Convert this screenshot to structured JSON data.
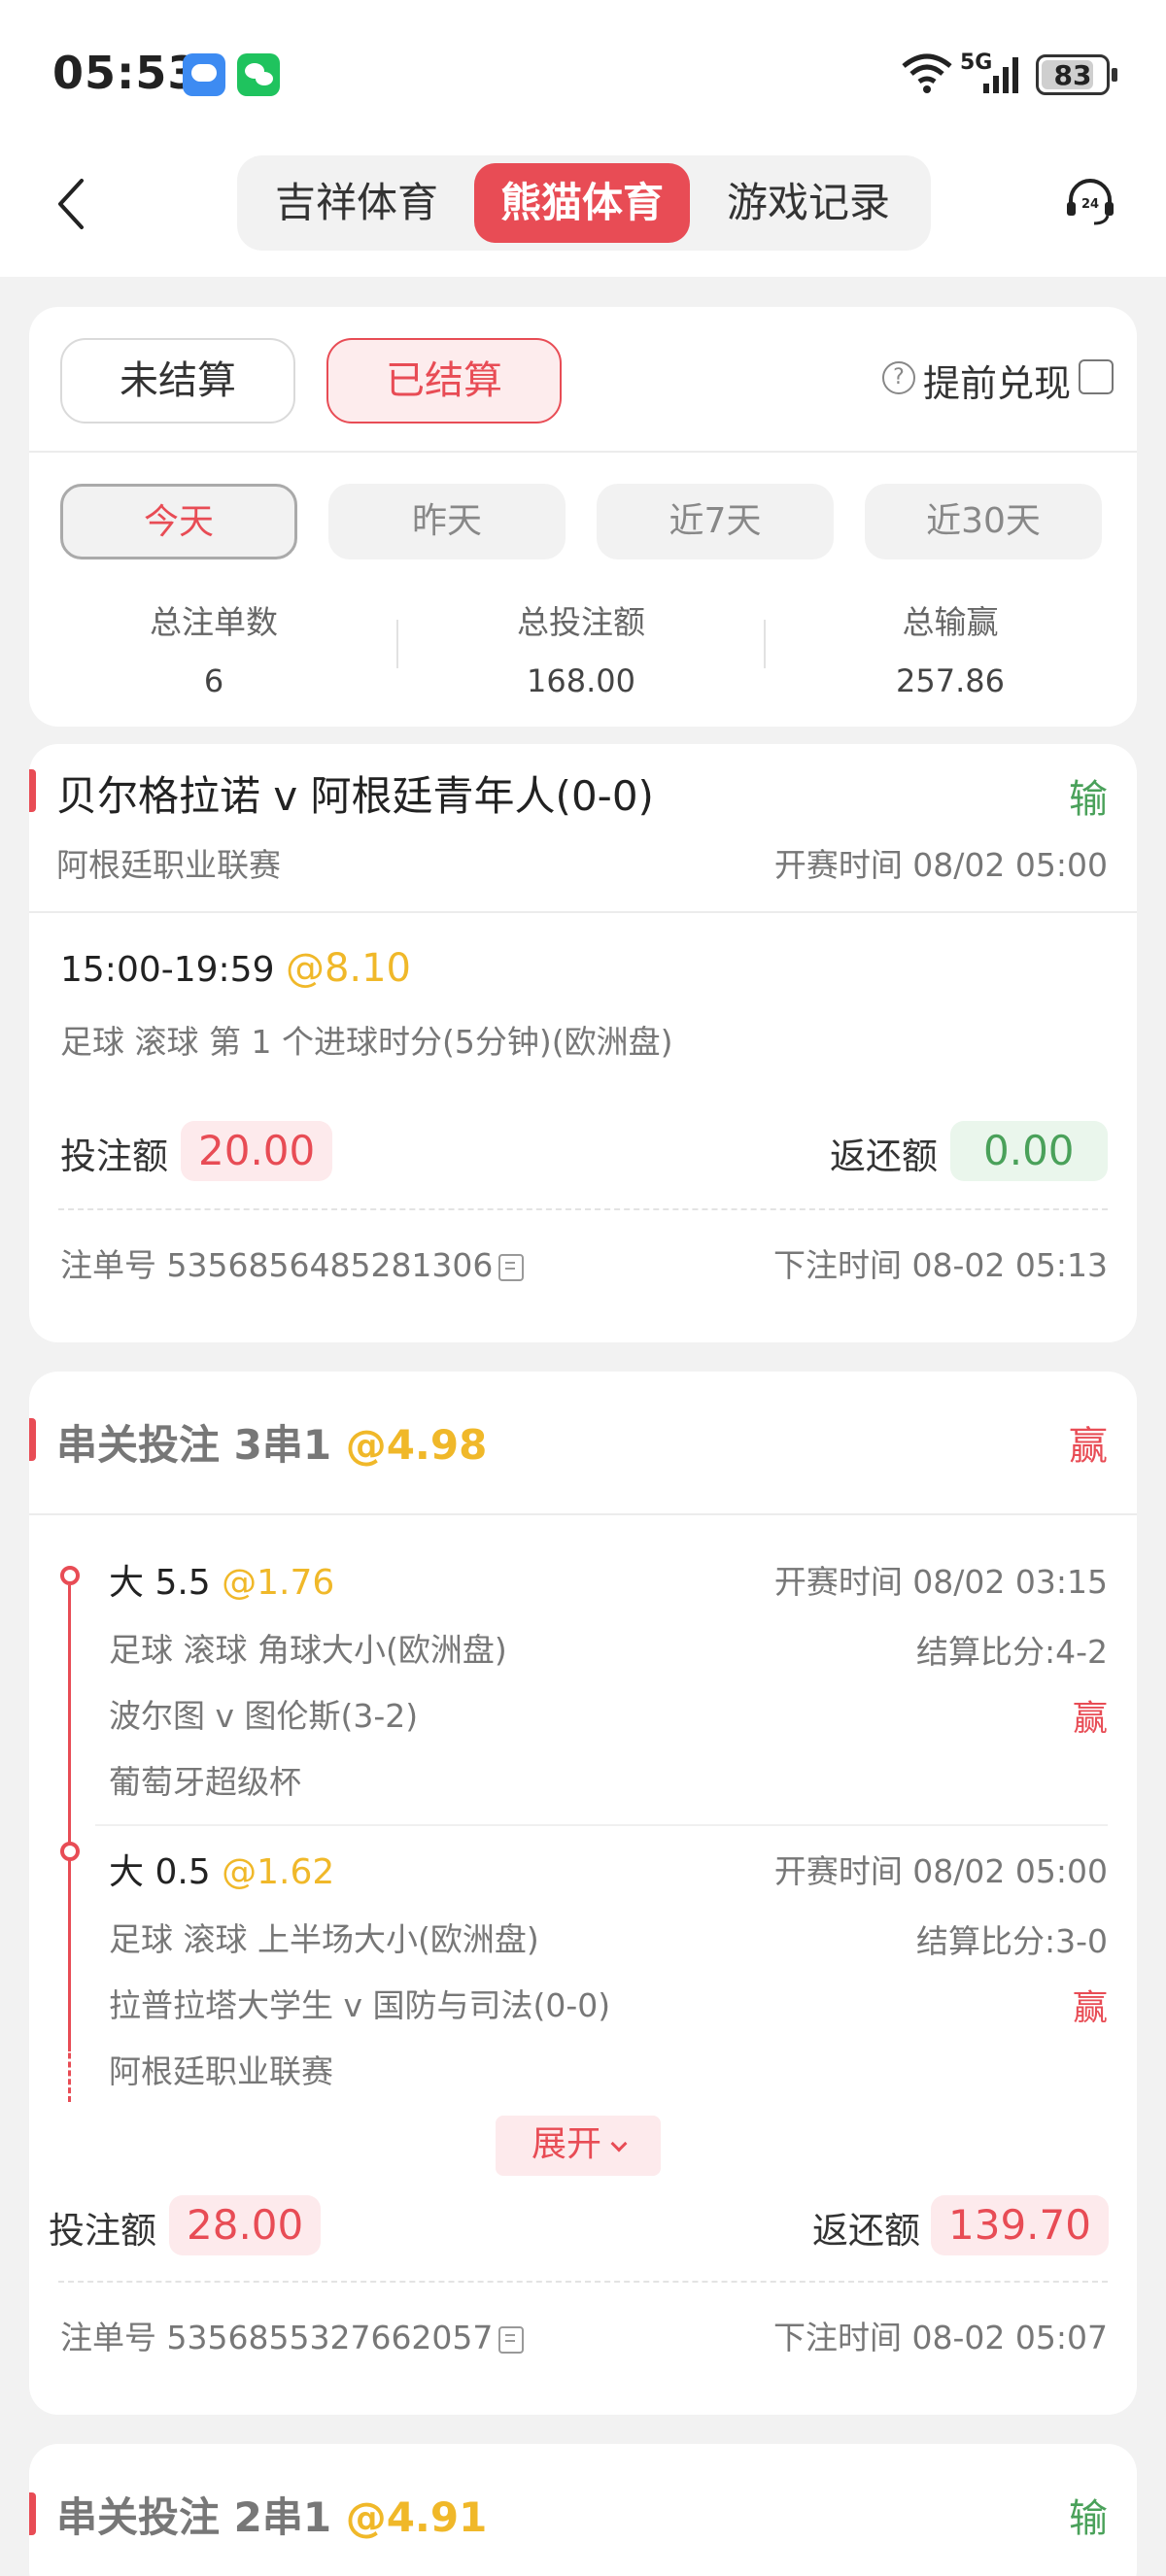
{
  "status_bar": {
    "time": "05:53",
    "network": "5G",
    "battery": "83",
    "battery_level": 0.83
  },
  "header": {
    "tabs": [
      "吉祥体育",
      "熊猫体育",
      "游戏记录"
    ],
    "active_tab": 1
  },
  "filters": {
    "status_tabs": [
      "未结算",
      "已结算"
    ],
    "active_status": 1,
    "early_cashout_label": "提前兑现",
    "help_icon": "question-circle-icon",
    "periods": [
      "今天",
      "昨天",
      "近7天",
      "近30天"
    ],
    "active_period": 0
  },
  "stats": [
    {
      "label": "总注单数",
      "value": "6"
    },
    {
      "label": "总投注额",
      "value": "168.00"
    },
    {
      "label": "总输赢",
      "value": "257.86"
    }
  ],
  "bet1": {
    "title": "贝尔格拉诺 v 阿根廷青年人(0-0)",
    "result": "输",
    "league": "阿根廷职业联赛",
    "start_time": "开赛时间 08/02 05:00",
    "selection": "15:00-19:59",
    "odds": "@8.10",
    "market": "足球 滚球 第 1 个进球时分(5分钟)(欧洲盘)",
    "stake_label": "投注额",
    "stake": "20.00",
    "return_label": "返还额",
    "return_value": "0.00",
    "order_no": "注单号 5356856485281306",
    "bet_time": "下注时间 08-02 05:13"
  },
  "bet2": {
    "title": "串关投注 3串1",
    "odds": "@4.98",
    "result": "赢",
    "legs": [
      {
        "selection": "大 5.5",
        "odds": "@1.76",
        "start_time": "开赛时间 08/02 03:15",
        "market": "足球 滚球 角球大小(欧洲盘)",
        "score": "结算比分:4-2",
        "match": "波尔图 v 图伦斯(3-2)",
        "result": "赢",
        "league": "葡萄牙超级杯"
      },
      {
        "selection": "大 0.5",
        "odds": "@1.62",
        "start_time": "开赛时间 08/02 05:00",
        "market": "足球 滚球 上半场大小(欧洲盘)",
        "score": "结算比分:3-0",
        "match": "拉普拉塔大学生 v 国防与司法(0-0)",
        "result": "赢",
        "league": "阿根廷职业联赛"
      }
    ],
    "expand_label": "展开",
    "stake_label": "投注额",
    "stake": "28.00",
    "return_label": "返还额",
    "return_value": "139.70",
    "order_no": "注单号 5356855327662057",
    "bet_time": "下注时间 08-02 05:07"
  },
  "bet3": {
    "title": "串关投注 2串1",
    "odds": "@4.91",
    "result": "输"
  },
  "colors": {
    "accent": "#e84c55",
    "win": "#e84c55",
    "lose": "#4aa15a",
    "odds": "#f0b829"
  }
}
